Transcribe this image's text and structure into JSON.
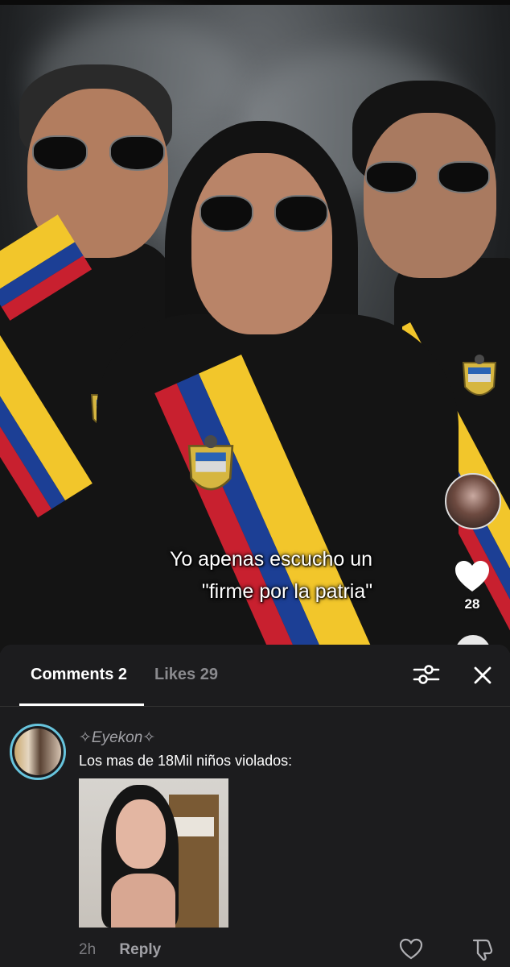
{
  "video": {
    "caption_line1": "Yo apenas escucho un",
    "caption_line2": "\"firme por la patria\"",
    "like_count": "28"
  },
  "comments_panel": {
    "tabs": [
      {
        "label": "Comments 2",
        "active": true
      },
      {
        "label": "Likes 29",
        "active": false
      }
    ],
    "comment": {
      "username": "✧Eyekon✧",
      "text": "Los mas de 18Mil niños violados:",
      "time": "2h",
      "reply_label": "Reply"
    }
  },
  "icons": {
    "filter": "sliders-icon",
    "close": "close-icon",
    "heart": "heart-icon",
    "dislike": "thumbs-down-icon"
  },
  "colors": {
    "sheet_background": "#1c1c1e",
    "avatar_ring": "#67c4dd",
    "flag_yellow": "#f2c62b",
    "flag_blue": "#1c3f95",
    "flag_red": "#c8202f"
  }
}
